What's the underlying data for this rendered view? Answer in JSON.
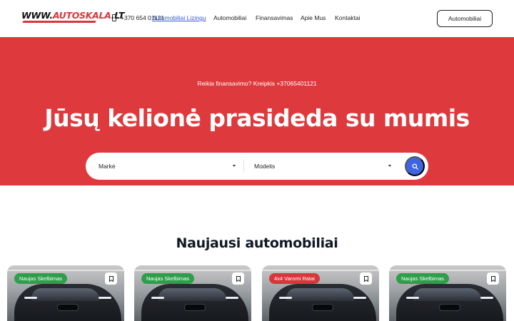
{
  "header": {
    "logo_prefix": "WWW.",
    "logo_brand": "AUTOSKALA",
    "logo_suffix": ".LT",
    "phone": "+370 654 01121",
    "nav": [
      {
        "label": "Automobiliai Lizingu",
        "active": true
      },
      {
        "label": "Automobiliai"
      },
      {
        "label": "Finansavimas"
      },
      {
        "label": "Apie Mus"
      },
      {
        "label": "Kontaktai"
      }
    ],
    "cta_label": "Automobiliai"
  },
  "hero": {
    "subtitle": "Reikia finansavimo? Kreipkis +37065401121",
    "title": "Jūsų kelionė prasideda su mumis",
    "background_color": "#de3a3d",
    "search": {
      "make_value": "Markė",
      "model_value": "Modelis",
      "search_icon": "search-icon",
      "button_color": "#3e64e0"
    }
  },
  "latest": {
    "title": "Naujausi automobiliai",
    "cards": [
      {
        "badge": "Naujas Skelbimas",
        "badge_color": "#2e9e4a"
      },
      {
        "badge": "Naujas Skelbimas",
        "badge_color": "#2e9e4a"
      },
      {
        "badge": "4x4 Varomi Ratai",
        "badge_color": "#d8363a"
      },
      {
        "badge": "Naujas Skelbimas",
        "badge_color": "#2e9e4a"
      }
    ]
  }
}
